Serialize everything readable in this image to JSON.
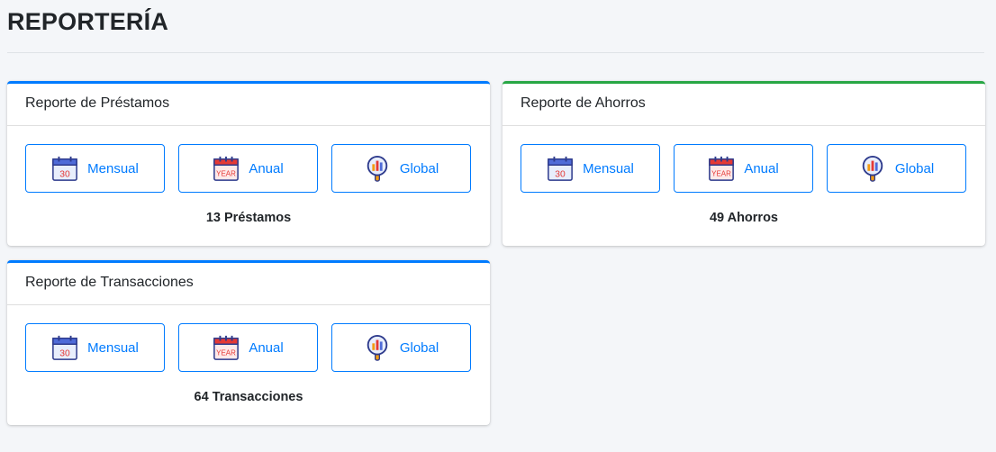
{
  "page": {
    "title": "REPORTERÍA"
  },
  "cards": [
    {
      "header": "Reporte de Préstamos",
      "buttons": {
        "monthly": "Mensual",
        "monthly_day": "30",
        "annual": "Anual",
        "annual_word": "YEAR",
        "global": "Global"
      },
      "count": "13 Préstamos",
      "accent": "#007bff"
    },
    {
      "header": "Reporte de Ahorros",
      "buttons": {
        "monthly": "Mensual",
        "monthly_day": "30",
        "annual": "Anual",
        "annual_word": "YEAR",
        "global": "Global"
      },
      "count": "49 Ahorros",
      "accent": "#28a745"
    },
    {
      "header": "Reporte de Transacciones",
      "buttons": {
        "monthly": "Mensual",
        "monthly_day": "30",
        "annual": "Anual",
        "annual_word": "YEAR",
        "global": "Global"
      },
      "count": "64 Transacciones",
      "accent": "#007bff"
    }
  ],
  "icons": {
    "monthly": "calendar-month-icon",
    "annual": "calendar-year-icon",
    "global": "magnifier-chart-icon"
  }
}
